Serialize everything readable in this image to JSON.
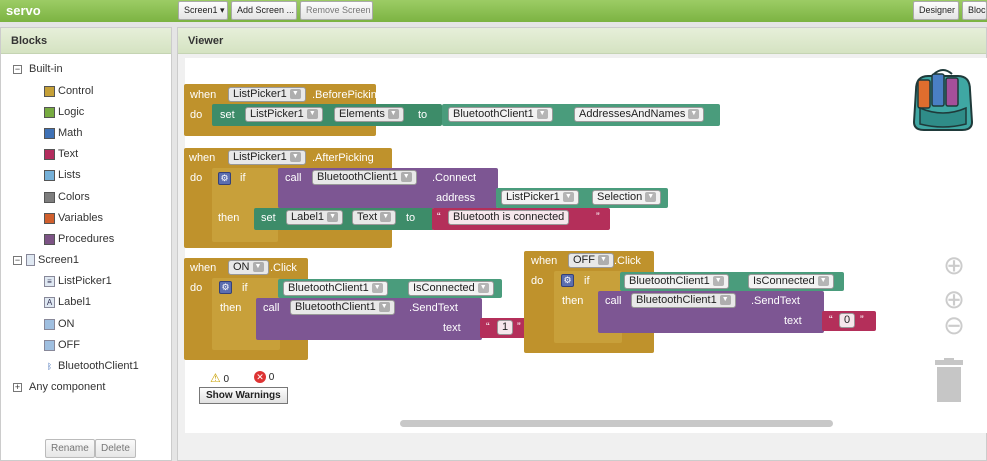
{
  "app": {
    "name": "servo"
  },
  "toolbar": {
    "screen": "Screen1 ▾",
    "add_screen": "Add Screen ...",
    "remove_screen": "Remove Screen",
    "designer": "Designer",
    "blocks": "Blocks"
  },
  "blocks_panel": {
    "title": "Blocks",
    "builtin": "Built-in",
    "categories": [
      {
        "label": "Control",
        "color": "#c5a037"
      },
      {
        "label": "Logic",
        "color": "#77ab41"
      },
      {
        "label": "Math",
        "color": "#3f71b5"
      },
      {
        "label": "Text",
        "color": "#b32d5e"
      },
      {
        "label": "Lists",
        "color": "#75b0d8"
      },
      {
        "label": "Colors",
        "color": "#7d7d7d"
      },
      {
        "label": "Variables",
        "color": "#d05f2d"
      },
      {
        "label": "Procedures",
        "color": "#7c5385"
      }
    ],
    "screen": "Screen1",
    "components": [
      "ListPicker1",
      "Label1",
      "ON",
      "OFF",
      "BluetoothClient1"
    ],
    "any_component": "Any component",
    "rename": "Rename",
    "delete": "Delete"
  },
  "viewer": {
    "title": "Viewer",
    "warnings_count": "0",
    "errors_count": "0",
    "show_warnings": "Show Warnings"
  },
  "blocks": {
    "b1": {
      "when": "when",
      "comp": "ListPicker1",
      "event": ".BeforePicking",
      "do": "do",
      "set": "set",
      "prop": "Elements",
      "to": "to",
      "getcomp": "BluetoothClient1",
      "getprop": "AddressesAndNames"
    },
    "b2": {
      "when": "when",
      "comp": "ListPicker1",
      "event": ".AfterPicking",
      "do": "do",
      "if": "if",
      "call": "call",
      "callcomp": "BluetoothClient1",
      "method": ".Connect",
      "address": "address",
      "addrcomp": "ListPicker1",
      "addrprop": "Selection",
      "then": "then",
      "set": "set",
      "setcomp": "Label1",
      "setprop": "Text",
      "to": "to",
      "text": "Bluetooth is connected"
    },
    "b3": {
      "when": "when",
      "comp": "ON",
      "event": ".Click",
      "do": "do",
      "if": "if",
      "ifcomp": "BluetoothClient1",
      "ifprop": "IsConnected",
      "then": "then",
      "call": "call",
      "callcomp": "BluetoothClient1",
      "method": ".SendText",
      "text_label": "text",
      "text": "1"
    },
    "b4": {
      "when": "when",
      "comp": "OFF",
      "event": ".Click",
      "do": "do",
      "if": "if",
      "ifcomp": "BluetoothClient1",
      "ifprop": "IsConnected",
      "then": "then",
      "call": "call",
      "callcomp": "BluetoothClient1",
      "method": ".SendText",
      "text_label": "text",
      "text": "0"
    }
  }
}
